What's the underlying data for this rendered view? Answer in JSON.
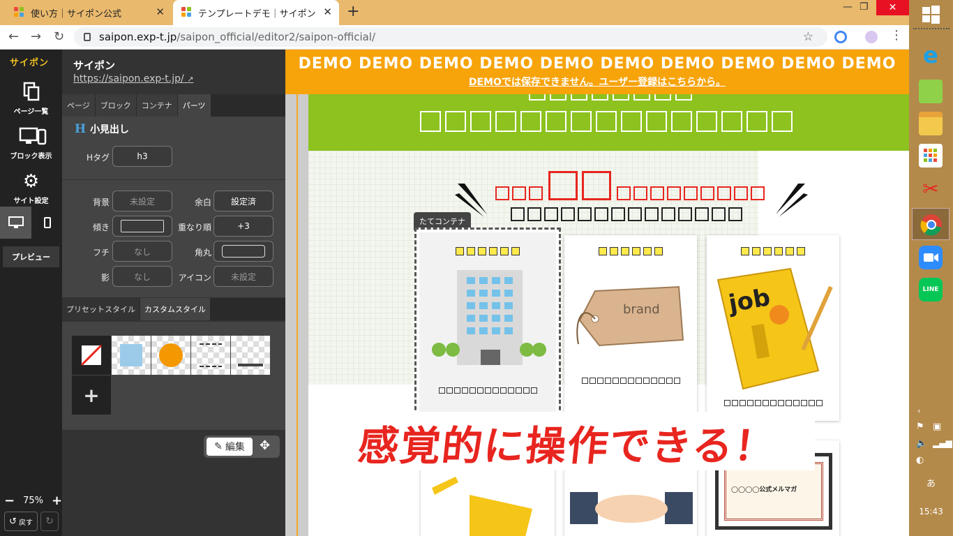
{
  "browser": {
    "tabs": [
      {
        "title": "使い方｜サイポン公式",
        "active": false
      },
      {
        "title": "テンプレートデモ｜サイポン",
        "active": true
      }
    ],
    "url_host": "saipon.exp-t.jp",
    "url_path": "/saipon_official/editor2/saipon-official/"
  },
  "leftnav": {
    "logo": "サイポン",
    "items": [
      "ページ一覧",
      "ブロック表示",
      "サイト設定"
    ],
    "preview": "プレビュー",
    "zoom": "75%",
    "undo": "戻す"
  },
  "panel": {
    "site_name": "サイポン",
    "site_url": "https://saipon.exp-t.jp/",
    "tabs": [
      "ページ",
      "ブロック",
      "コンテナ",
      "パーツ"
    ],
    "section_title": "小見出し",
    "section_icon": "H",
    "htag_label": "Hタグ",
    "htag_value": "h3",
    "fields": {
      "bg_label": "背景",
      "bg_value": "未設定",
      "margin_label": "余白",
      "margin_value": "設定済",
      "tilt_label": "傾き",
      "zorder_label": "重なり順",
      "zorder_value": "+3",
      "border_label": "フチ",
      "border_value": "なし",
      "radius_label": "角丸",
      "shadow_label": "影",
      "shadow_value": "なし",
      "icon_label": "アイコン",
      "icon_value": "未設定"
    },
    "style_tabs": [
      "プリセットスタイル",
      "カスタムスタイル"
    ],
    "edit_label": "編集"
  },
  "canvas": {
    "demo_banner": "DEMO DEMO DEMO DEMO DEMO DEMO DEMO DEMO DEMO DEMO",
    "demo_notice": "DEMOでは保存できません。ユーザー登録はこちらから。",
    "container_tag": "たてコンテナ",
    "card_images": [
      "building-illustration",
      "brand-tag-illustration",
      "job-book-illustration"
    ],
    "brand_text": "brand",
    "job_text": "job",
    "slogan": "感覚的に操作できる！",
    "mailmag_text": "◯◯◯◯公式メルマガ"
  },
  "taskbar": {
    "time": "15:43",
    "ime": "あ"
  },
  "colors": {
    "accent_orange": "#f7a30a",
    "green": "#8dc21f",
    "slogan_red": "#e8251f"
  }
}
